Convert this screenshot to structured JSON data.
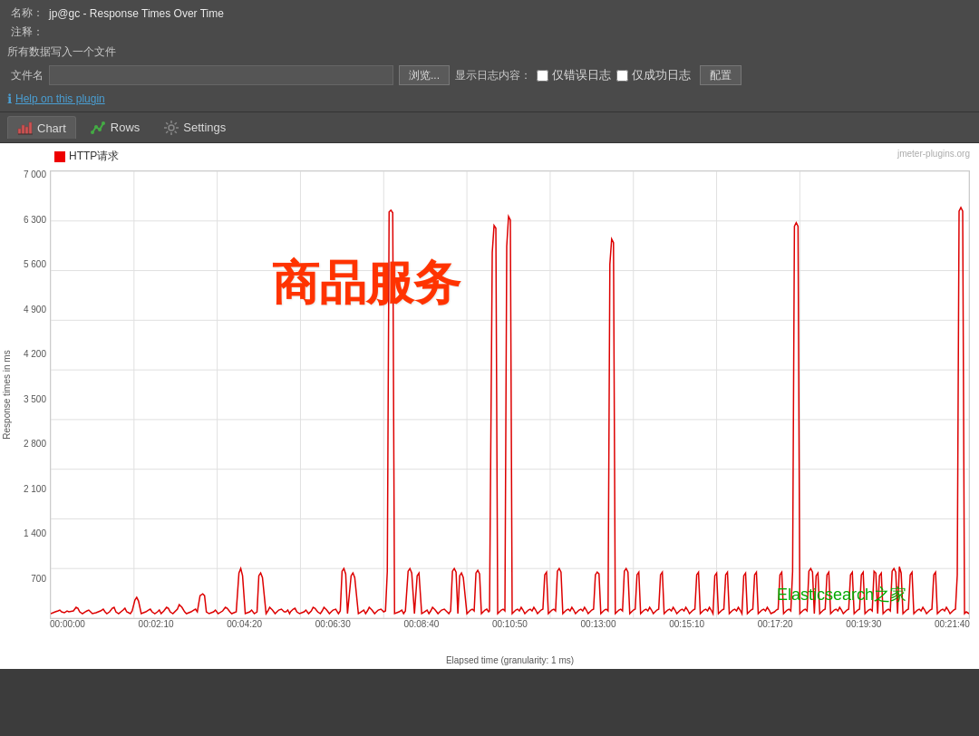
{
  "header": {
    "name_label": "名称：",
    "name_value": "jp@gc - Response Times Over Time",
    "comment_label": "注释：",
    "comment_value": "",
    "all_data_label": "所有数据写入一个文件",
    "file_label": "文件名",
    "file_value": "",
    "browse_label": "浏览...",
    "log_display_label": "显示日志内容：",
    "error_only_label": "仅错误日志",
    "success_only_label": "仅成功日志",
    "config_label": "配置",
    "help_icon": "ℹ",
    "help_text": "Help on this plugin"
  },
  "tabs": [
    {
      "id": "chart",
      "label": "Chart",
      "active": true,
      "icon": "chart"
    },
    {
      "id": "rows",
      "label": "Rows",
      "active": false,
      "icon": "rows"
    },
    {
      "id": "settings",
      "label": "Settings",
      "active": false,
      "icon": "settings"
    }
  ],
  "chart": {
    "title": "Response Times Over Time",
    "watermark": "jmeter-plugins.org",
    "legend_label": "HTTP请求",
    "y_axis_title": "Response times in ms",
    "x_axis_title": "Elapsed time (granularity: 1 ms)",
    "y_labels": [
      "7 000",
      "6 300",
      "5 600",
      "4 900",
      "4 200",
      "3 500",
      "2 800",
      "2 100",
      "1 400",
      "700",
      ""
    ],
    "x_labels": [
      "00:00:00",
      "00:02:10",
      "00:04:20",
      "00:06:30",
      "00:08:40",
      "00:10:50",
      "00:13:00",
      "00:15:10",
      "00:17:20",
      "00:19:30",
      "00:21:40"
    ],
    "overlay_text": "商品服务",
    "overlay_text2": "Elasticsearch之家"
  }
}
